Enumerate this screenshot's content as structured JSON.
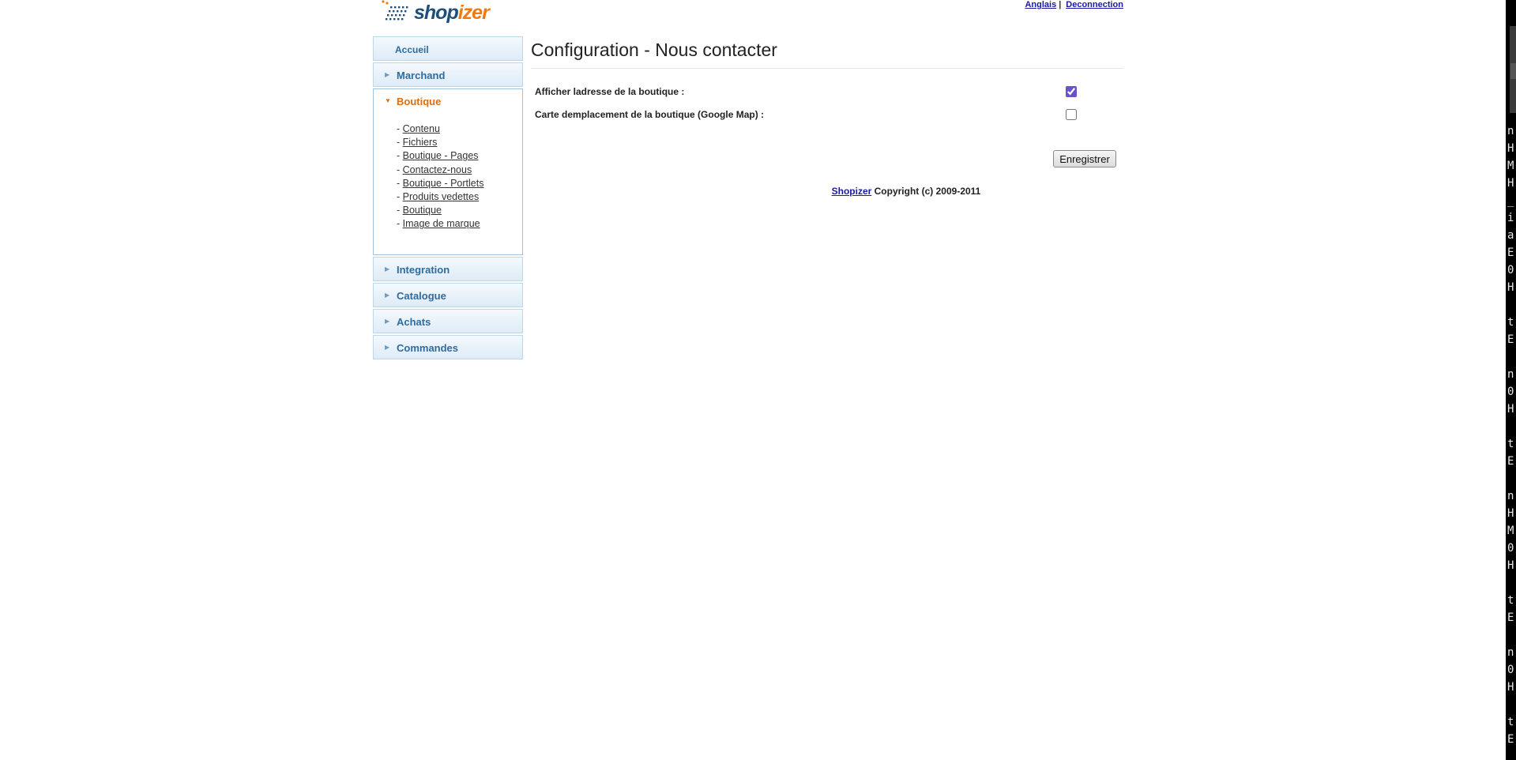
{
  "header": {
    "logo": {
      "part1": "shop",
      "part2": "izer"
    },
    "lang_link": "Anglais",
    "separator": "|",
    "logout_link": "Deconnection"
  },
  "sidebar": {
    "home": "Accueil",
    "sections": [
      {
        "label": "Marchand"
      },
      {
        "label": "Boutique",
        "active": true
      },
      {
        "label": "Integration"
      },
      {
        "label": "Catalogue"
      },
      {
        "label": "Achats"
      },
      {
        "label": "Commandes"
      }
    ],
    "boutique_items": [
      "Contenu",
      "Fichiers",
      "Boutique - Pages",
      "Contactez-nous",
      "Boutique - Portlets",
      "Produits vedettes",
      "Boutique",
      "Image de marque"
    ],
    "item_prefix": "- "
  },
  "main": {
    "title": "Configuration - Nous contacter",
    "fields": [
      {
        "label": "Afficher ladresse de la boutique :",
        "checked": true
      },
      {
        "label": "Carte demplacement de la boutique (Google Map) :",
        "checked": false
      }
    ],
    "save_label": "Enregistrer"
  },
  "footer": {
    "link": "Shopizer",
    "text": " Copyright (c) 2009-2011"
  },
  "edge_strip_chars": [
    "n",
    "H",
    "M",
    "H",
    "_",
    "i",
    "a",
    "E",
    "0",
    "H",
    "",
    "t",
    "E",
    "",
    "n",
    "0",
    "H",
    "",
    "t",
    "E",
    "",
    "n",
    "H",
    "M",
    "0",
    "H",
    "",
    "t",
    "E",
    "",
    "n",
    "0",
    "H",
    "",
    "t",
    "E"
  ],
  "colors": {
    "brand_blue": "#1d4f7a",
    "brand_orange": "#f07a10",
    "sidebar_label": "#2f6b9f",
    "active_label": "#e06d0a",
    "link": "#1a1aa6"
  }
}
